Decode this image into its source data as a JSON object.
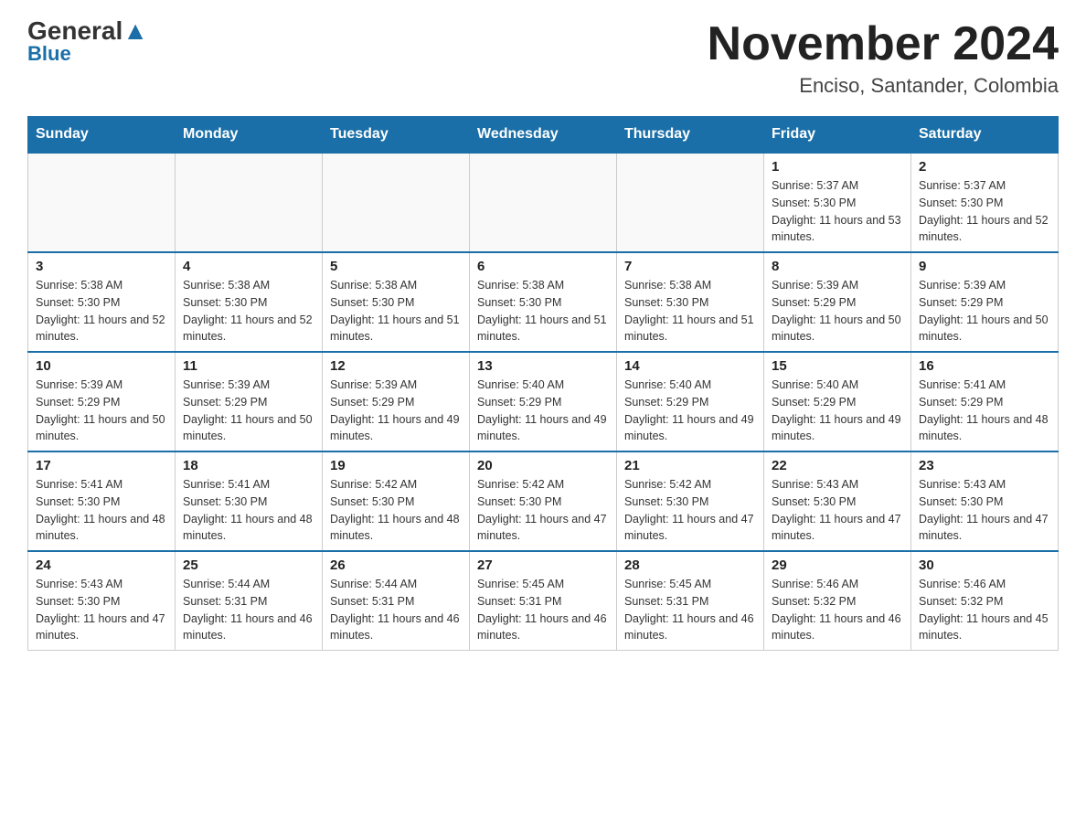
{
  "header": {
    "logo_general": "General",
    "logo_blue": "Blue",
    "main_title": "November 2024",
    "subtitle": "Enciso, Santander, Colombia"
  },
  "days_of_week": [
    "Sunday",
    "Monday",
    "Tuesday",
    "Wednesday",
    "Thursday",
    "Friday",
    "Saturday"
  ],
  "weeks": [
    [
      {
        "num": "",
        "info": ""
      },
      {
        "num": "",
        "info": ""
      },
      {
        "num": "",
        "info": ""
      },
      {
        "num": "",
        "info": ""
      },
      {
        "num": "",
        "info": ""
      },
      {
        "num": "1",
        "info": "Sunrise: 5:37 AM\nSunset: 5:30 PM\nDaylight: 11 hours and 53 minutes."
      },
      {
        "num": "2",
        "info": "Sunrise: 5:37 AM\nSunset: 5:30 PM\nDaylight: 11 hours and 52 minutes."
      }
    ],
    [
      {
        "num": "3",
        "info": "Sunrise: 5:38 AM\nSunset: 5:30 PM\nDaylight: 11 hours and 52 minutes."
      },
      {
        "num": "4",
        "info": "Sunrise: 5:38 AM\nSunset: 5:30 PM\nDaylight: 11 hours and 52 minutes."
      },
      {
        "num": "5",
        "info": "Sunrise: 5:38 AM\nSunset: 5:30 PM\nDaylight: 11 hours and 51 minutes."
      },
      {
        "num": "6",
        "info": "Sunrise: 5:38 AM\nSunset: 5:30 PM\nDaylight: 11 hours and 51 minutes."
      },
      {
        "num": "7",
        "info": "Sunrise: 5:38 AM\nSunset: 5:30 PM\nDaylight: 11 hours and 51 minutes."
      },
      {
        "num": "8",
        "info": "Sunrise: 5:39 AM\nSunset: 5:29 PM\nDaylight: 11 hours and 50 minutes."
      },
      {
        "num": "9",
        "info": "Sunrise: 5:39 AM\nSunset: 5:29 PM\nDaylight: 11 hours and 50 minutes."
      }
    ],
    [
      {
        "num": "10",
        "info": "Sunrise: 5:39 AM\nSunset: 5:29 PM\nDaylight: 11 hours and 50 minutes."
      },
      {
        "num": "11",
        "info": "Sunrise: 5:39 AM\nSunset: 5:29 PM\nDaylight: 11 hours and 50 minutes."
      },
      {
        "num": "12",
        "info": "Sunrise: 5:39 AM\nSunset: 5:29 PM\nDaylight: 11 hours and 49 minutes."
      },
      {
        "num": "13",
        "info": "Sunrise: 5:40 AM\nSunset: 5:29 PM\nDaylight: 11 hours and 49 minutes."
      },
      {
        "num": "14",
        "info": "Sunrise: 5:40 AM\nSunset: 5:29 PM\nDaylight: 11 hours and 49 minutes."
      },
      {
        "num": "15",
        "info": "Sunrise: 5:40 AM\nSunset: 5:29 PM\nDaylight: 11 hours and 49 minutes."
      },
      {
        "num": "16",
        "info": "Sunrise: 5:41 AM\nSunset: 5:29 PM\nDaylight: 11 hours and 48 minutes."
      }
    ],
    [
      {
        "num": "17",
        "info": "Sunrise: 5:41 AM\nSunset: 5:30 PM\nDaylight: 11 hours and 48 minutes."
      },
      {
        "num": "18",
        "info": "Sunrise: 5:41 AM\nSunset: 5:30 PM\nDaylight: 11 hours and 48 minutes."
      },
      {
        "num": "19",
        "info": "Sunrise: 5:42 AM\nSunset: 5:30 PM\nDaylight: 11 hours and 48 minutes."
      },
      {
        "num": "20",
        "info": "Sunrise: 5:42 AM\nSunset: 5:30 PM\nDaylight: 11 hours and 47 minutes."
      },
      {
        "num": "21",
        "info": "Sunrise: 5:42 AM\nSunset: 5:30 PM\nDaylight: 11 hours and 47 minutes."
      },
      {
        "num": "22",
        "info": "Sunrise: 5:43 AM\nSunset: 5:30 PM\nDaylight: 11 hours and 47 minutes."
      },
      {
        "num": "23",
        "info": "Sunrise: 5:43 AM\nSunset: 5:30 PM\nDaylight: 11 hours and 47 minutes."
      }
    ],
    [
      {
        "num": "24",
        "info": "Sunrise: 5:43 AM\nSunset: 5:30 PM\nDaylight: 11 hours and 47 minutes."
      },
      {
        "num": "25",
        "info": "Sunrise: 5:44 AM\nSunset: 5:31 PM\nDaylight: 11 hours and 46 minutes."
      },
      {
        "num": "26",
        "info": "Sunrise: 5:44 AM\nSunset: 5:31 PM\nDaylight: 11 hours and 46 minutes."
      },
      {
        "num": "27",
        "info": "Sunrise: 5:45 AM\nSunset: 5:31 PM\nDaylight: 11 hours and 46 minutes."
      },
      {
        "num": "28",
        "info": "Sunrise: 5:45 AM\nSunset: 5:31 PM\nDaylight: 11 hours and 46 minutes."
      },
      {
        "num": "29",
        "info": "Sunrise: 5:46 AM\nSunset: 5:32 PM\nDaylight: 11 hours and 46 minutes."
      },
      {
        "num": "30",
        "info": "Sunrise: 5:46 AM\nSunset: 5:32 PM\nDaylight: 11 hours and 45 minutes."
      }
    ]
  ]
}
